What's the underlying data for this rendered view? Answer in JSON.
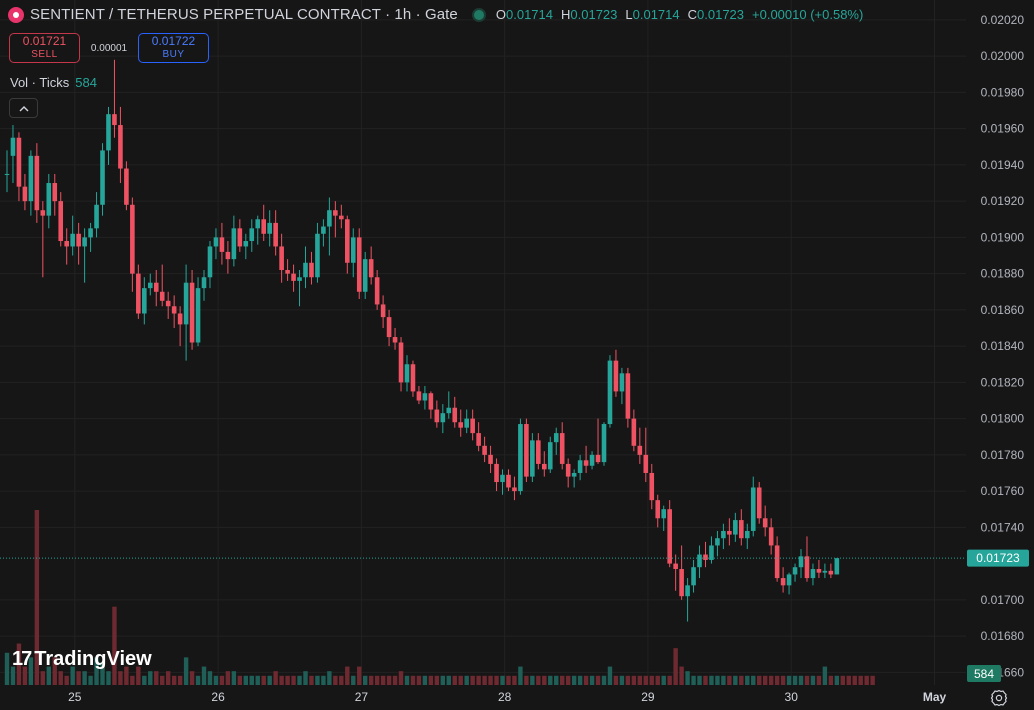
{
  "header": {
    "title": "SENTIENT / TETHERUS PERPETUAL CONTRACT · 1h · Gate",
    "ohlc": {
      "o_label": "O",
      "o_value": "0.01714",
      "h_label": "H",
      "h_value": "0.01723",
      "l_label": "L",
      "l_value": "0.01714",
      "c_label": "C",
      "c_value": "0.01723",
      "change": "+0.00010 (+0.58%)"
    }
  },
  "trade": {
    "sell_price": "0.01721",
    "sell_label": "SELL",
    "spread": "0.00001",
    "buy_price": "0.01722",
    "buy_label": "BUY"
  },
  "volume_indicator": {
    "label": "Vol · Ticks",
    "value": "584"
  },
  "collapse_icon": "chevron-up-icon",
  "branding": {
    "logo_mark": "17",
    "logo_text": "TradingView"
  },
  "settings_icon": "gear-icon",
  "colors": {
    "up": "#26a69a",
    "down": "#ef5363",
    "up_vol": "#1f5f57",
    "down_vol": "#6e2a30",
    "background": "#161616",
    "grid": "#222222"
  },
  "current_price_tag": "0.01723",
  "volume_tag": "584",
  "chart_data": {
    "type": "candlestick",
    "title": "SENTIENT / TETHERUS PERPETUAL CONTRACT · 1h · Gate",
    "price_ticks": [
      "0.02020",
      "0.02000",
      "0.01980",
      "0.01960",
      "0.01940",
      "0.01920",
      "0.01900",
      "0.01880",
      "0.01860",
      "0.01840",
      "0.01820",
      "0.01800",
      "0.01780",
      "0.01760",
      "0.01740",
      "0.01700",
      "0.01680",
      "0.01660"
    ],
    "ylim": [
      0.01653,
      0.02031
    ],
    "x_ticks": [
      {
        "label": "25",
        "index": 6
      },
      {
        "label": "26",
        "index": 30
      },
      {
        "label": "27",
        "index": 54
      },
      {
        "label": "28",
        "index": 78
      },
      {
        "label": "29",
        "index": 102
      },
      {
        "label": "30",
        "index": 126
      },
      {
        "label": "May",
        "index": 150
      }
    ],
    "grid": true,
    "current_price": 0.01723,
    "ohlc": [
      [
        0.01935,
        0.01948,
        0.01925,
        0.01935
      ],
      [
        0.01945,
        0.01962,
        0.0193,
        0.01955
      ],
      [
        0.01955,
        0.01958,
        0.0192,
        0.01928
      ],
      [
        0.01928,
        0.01935,
        0.01915,
        0.0192
      ],
      [
        0.0192,
        0.01948,
        0.01912,
        0.01945
      ],
      [
        0.01945,
        0.01952,
        0.01908,
        0.01915
      ],
      [
        0.01915,
        0.0192,
        0.01878,
        0.01912
      ],
      [
        0.01912,
        0.01935,
        0.01905,
        0.0193
      ],
      [
        0.0193,
        0.01935,
        0.01912,
        0.0192
      ],
      [
        0.0192,
        0.01925,
        0.01895,
        0.01898
      ],
      [
        0.01898,
        0.01905,
        0.01885,
        0.01895
      ],
      [
        0.01895,
        0.01912,
        0.0189,
        0.01902
      ],
      [
        0.01902,
        0.01908,
        0.01885,
        0.01895
      ],
      [
        0.01895,
        0.01905,
        0.01875,
        0.019
      ],
      [
        0.019,
        0.01908,
        0.01892,
        0.01905
      ],
      [
        0.01905,
        0.01925,
        0.019,
        0.01918
      ],
      [
        0.01918,
        0.01952,
        0.01912,
        0.01948
      ],
      [
        0.01948,
        0.01972,
        0.0194,
        0.01968
      ],
      [
        0.01968,
        0.01998,
        0.01955,
        0.01962
      ],
      [
        0.01962,
        0.01972,
        0.0193,
        0.01938
      ],
      [
        0.01938,
        0.01942,
        0.01915,
        0.01918
      ],
      [
        0.01918,
        0.01922,
        0.0187,
        0.0188
      ],
      [
        0.0188,
        0.01885,
        0.01855,
        0.01858
      ],
      [
        0.01858,
        0.01878,
        0.01852,
        0.01872
      ],
      [
        0.01872,
        0.0188,
        0.01868,
        0.01875
      ],
      [
        0.01875,
        0.01882,
        0.01862,
        0.0187
      ],
      [
        0.0187,
        0.01885,
        0.01862,
        0.01865
      ],
      [
        0.01865,
        0.0187,
        0.01855,
        0.01862
      ],
      [
        0.01862,
        0.01868,
        0.0185,
        0.01858
      ],
      [
        0.01858,
        0.01862,
        0.0184,
        0.01852
      ],
      [
        0.01852,
        0.01885,
        0.01832,
        0.01875
      ],
      [
        0.01875,
        0.01882,
        0.01838,
        0.01842
      ],
      [
        0.01842,
        0.01878,
        0.0184,
        0.01872
      ],
      [
        0.01872,
        0.01882,
        0.01865,
        0.01878
      ],
      [
        0.01878,
        0.01898,
        0.01872,
        0.01895
      ],
      [
        0.01895,
        0.01905,
        0.01888,
        0.019
      ],
      [
        0.019,
        0.01908,
        0.01885,
        0.01892
      ],
      [
        0.01892,
        0.01898,
        0.0188,
        0.01888
      ],
      [
        0.01888,
        0.01912,
        0.01884,
        0.01905
      ],
      [
        0.01905,
        0.0191,
        0.01892,
        0.01895
      ],
      [
        0.01895,
        0.01902,
        0.01888,
        0.01898
      ],
      [
        0.01898,
        0.0191,
        0.01892,
        0.01905
      ],
      [
        0.01905,
        0.01912,
        0.01896,
        0.0191
      ],
      [
        0.0191,
        0.01918,
        0.01898,
        0.01902
      ],
      [
        0.01902,
        0.01915,
        0.01895,
        0.01908
      ],
      [
        0.01908,
        0.01915,
        0.0189,
        0.01895
      ],
      [
        0.01895,
        0.01902,
        0.01875,
        0.01882
      ],
      [
        0.01882,
        0.01888,
        0.01876,
        0.0188
      ],
      [
        0.0188,
        0.01885,
        0.0187,
        0.01876
      ],
      [
        0.01876,
        0.01882,
        0.01862,
        0.01878
      ],
      [
        0.01878,
        0.01895,
        0.01872,
        0.01886
      ],
      [
        0.01886,
        0.01892,
        0.01874,
        0.01878
      ],
      [
        0.01878,
        0.01908,
        0.01875,
        0.01902
      ],
      [
        0.01902,
        0.0191,
        0.01895,
        0.01906
      ],
      [
        0.01906,
        0.01922,
        0.0189,
        0.01915
      ],
      [
        0.01915,
        0.0192,
        0.019,
        0.01912
      ],
      [
        0.01912,
        0.01918,
        0.01905,
        0.0191
      ],
      [
        0.0191,
        0.01912,
        0.0188,
        0.01886
      ],
      [
        0.01886,
        0.01905,
        0.01878,
        0.019
      ],
      [
        0.019,
        0.01905,
        0.01866,
        0.0187
      ],
      [
        0.0187,
        0.01892,
        0.01866,
        0.01888
      ],
      [
        0.01888,
        0.01895,
        0.01874,
        0.01878
      ],
      [
        0.01878,
        0.01882,
        0.0186,
        0.01863
      ],
      [
        0.01863,
        0.01868,
        0.0185,
        0.01856
      ],
      [
        0.01856,
        0.0186,
        0.0184,
        0.01845
      ],
      [
        0.01845,
        0.0185,
        0.01838,
        0.01842
      ],
      [
        0.01842,
        0.01845,
        0.01815,
        0.0182
      ],
      [
        0.0182,
        0.01835,
        0.01815,
        0.0183
      ],
      [
        0.0183,
        0.01832,
        0.01812,
        0.01815
      ],
      [
        0.01815,
        0.01818,
        0.01808,
        0.0181
      ],
      [
        0.0181,
        0.01818,
        0.01805,
        0.01814
      ],
      [
        0.01814,
        0.01815,
        0.018,
        0.01805
      ],
      [
        0.01805,
        0.0181,
        0.01795,
        0.01798
      ],
      [
        0.01798,
        0.01808,
        0.01792,
        0.01803
      ],
      [
        0.01803,
        0.01815,
        0.018,
        0.01806
      ],
      [
        0.01806,
        0.01812,
        0.01795,
        0.01798
      ],
      [
        0.01798,
        0.01805,
        0.0179,
        0.01795
      ],
      [
        0.01795,
        0.01805,
        0.01792,
        0.018
      ],
      [
        0.018,
        0.01805,
        0.01788,
        0.01792
      ],
      [
        0.01792,
        0.01798,
        0.01782,
        0.01785
      ],
      [
        0.01785,
        0.0179,
        0.01776,
        0.0178
      ],
      [
        0.0178,
        0.01785,
        0.0177,
        0.01775
      ],
      [
        0.01775,
        0.01778,
        0.0176,
        0.01765
      ],
      [
        0.01765,
        0.01772,
        0.01758,
        0.01769
      ],
      [
        0.01769,
        0.01772,
        0.0176,
        0.01762
      ],
      [
        0.01762,
        0.01768,
        0.01755,
        0.0176
      ],
      [
        0.0176,
        0.018,
        0.01758,
        0.01797
      ],
      [
        0.01797,
        0.018,
        0.01765,
        0.01768
      ],
      [
        0.01768,
        0.01792,
        0.01765,
        0.01788
      ],
      [
        0.01788,
        0.01792,
        0.01772,
        0.01775
      ],
      [
        0.01775,
        0.01782,
        0.01768,
        0.01772
      ],
      [
        0.01772,
        0.0179,
        0.0177,
        0.01787
      ],
      [
        0.01787,
        0.01795,
        0.0178,
        0.01792
      ],
      [
        0.01792,
        0.01798,
        0.01772,
        0.01775
      ],
      [
        0.01775,
        0.01778,
        0.01762,
        0.01768
      ],
      [
        0.01768,
        0.01772,
        0.01762,
        0.0177
      ],
      [
        0.0177,
        0.0178,
        0.01766,
        0.01777
      ],
      [
        0.01777,
        0.01785,
        0.0177,
        0.01774
      ],
      [
        0.01774,
        0.01782,
        0.01772,
        0.0178
      ],
      [
        0.0178,
        0.018,
        0.01775,
        0.01776
      ],
      [
        0.01776,
        0.01798,
        0.01774,
        0.01797
      ],
      [
        0.01797,
        0.01835,
        0.01795,
        0.01832
      ],
      [
        0.01832,
        0.01838,
        0.01812,
        0.01815
      ],
      [
        0.01815,
        0.01828,
        0.01808,
        0.01825
      ],
      [
        0.01825,
        0.01828,
        0.01795,
        0.018
      ],
      [
        0.018,
        0.01805,
        0.01782,
        0.01785
      ],
      [
        0.01785,
        0.01795,
        0.01775,
        0.0178
      ],
      [
        0.0178,
        0.01795,
        0.01765,
        0.0177
      ],
      [
        0.0177,
        0.01775,
        0.0175,
        0.01755
      ],
      [
        0.01755,
        0.01758,
        0.0174,
        0.01745
      ],
      [
        0.01745,
        0.01752,
        0.01738,
        0.0175
      ],
      [
        0.0175,
        0.01755,
        0.01718,
        0.0172
      ],
      [
        0.0172,
        0.01725,
        0.01705,
        0.01717
      ],
      [
        0.01717,
        0.0173,
        0.017,
        0.01702
      ],
      [
        0.01702,
        0.01712,
        0.01688,
        0.01708
      ],
      [
        0.01708,
        0.01722,
        0.01704,
        0.01718
      ],
      [
        0.01718,
        0.0173,
        0.01712,
        0.01725
      ],
      [
        0.01725,
        0.01732,
        0.01718,
        0.01722
      ],
      [
        0.01722,
        0.01735,
        0.0172,
        0.0173
      ],
      [
        0.0173,
        0.01738,
        0.01724,
        0.01734
      ],
      [
        0.01734,
        0.01742,
        0.01728,
        0.01738
      ],
      [
        0.01738,
        0.01745,
        0.0173,
        0.01736
      ],
      [
        0.01736,
        0.01748,
        0.01732,
        0.01744
      ],
      [
        0.01744,
        0.0175,
        0.0173,
        0.01734
      ],
      [
        0.01734,
        0.01742,
        0.01728,
        0.01738
      ],
      [
        0.01738,
        0.01768,
        0.01735,
        0.01762
      ],
      [
        0.01762,
        0.01765,
        0.01742,
        0.01745
      ],
      [
        0.01745,
        0.01752,
        0.01735,
        0.0174
      ],
      [
        0.0174,
        0.01745,
        0.01725,
        0.0173
      ],
      [
        0.0173,
        0.01735,
        0.0171,
        0.01712
      ],
      [
        0.01712,
        0.01718,
        0.01704,
        0.01708
      ],
      [
        0.01708,
        0.01715,
        0.01703,
        0.01714
      ],
      [
        0.01714,
        0.0172,
        0.0171,
        0.01718
      ],
      [
        0.01718,
        0.01728,
        0.01712,
        0.01724
      ],
      [
        0.01724,
        0.01735,
        0.0171,
        0.01712
      ],
      [
        0.01712,
        0.0172,
        0.01708,
        0.01717
      ],
      [
        0.01717,
        0.01722,
        0.01712,
        0.01715
      ],
      [
        0.01715,
        0.0172,
        0.01712,
        0.01716
      ],
      [
        0.01716,
        0.0172,
        0.01712,
        0.01714
      ],
      [
        0.01714,
        0.01723,
        0.01714,
        0.01723
      ]
    ],
    "volume": [
      70,
      40,
      90,
      40,
      60,
      380,
      30,
      40,
      60,
      30,
      20,
      40,
      30,
      30,
      20,
      60,
      50,
      30,
      170,
      30,
      40,
      20,
      40,
      20,
      30,
      30,
      20,
      30,
      20,
      20,
      60,
      30,
      20,
      40,
      30,
      20,
      20,
      30,
      30,
      20,
      20,
      20,
      20,
      20,
      20,
      30,
      20,
      20,
      20,
      20,
      30,
      20,
      20,
      20,
      30,
      20,
      20,
      40,
      20,
      40,
      20,
      20,
      20,
      20,
      20,
      20,
      30,
      20,
      20,
      20,
      20,
      20,
      20,
      20,
      20,
      20,
      20,
      20,
      20,
      20,
      20,
      20,
      20,
      20,
      20,
      20,
      40,
      20,
      20,
      20,
      20,
      20,
      20,
      20,
      20,
      20,
      20,
      20,
      20,
      20,
      20,
      40,
      20,
      20,
      20,
      20,
      20,
      20,
      20,
      20,
      20,
      20,
      80,
      40,
      30,
      20,
      20,
      20,
      20,
      20,
      20,
      20,
      20,
      20,
      20,
      20,
      20,
      20,
      20,
      20,
      20,
      20,
      20,
      20,
      20,
      20,
      20,
      40,
      20,
      20,
      20,
      20,
      20,
      20,
      20,
      20
    ]
  }
}
